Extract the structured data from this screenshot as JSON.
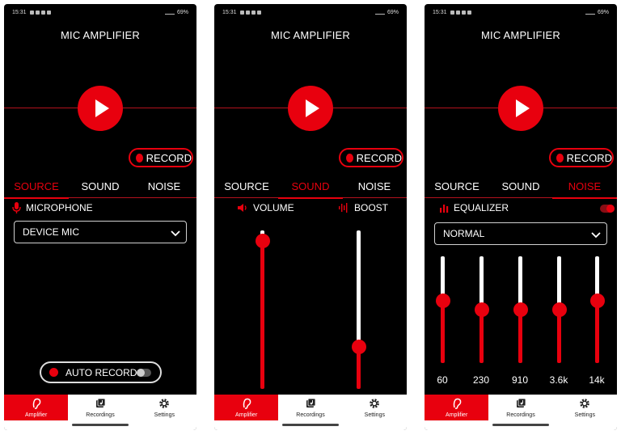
{
  "status": {
    "time": "15:31",
    "battery": "69%"
  },
  "app": {
    "title": "MIC AMPLIFIER",
    "record_label": "RECORD"
  },
  "tabs": [
    "SOURCE",
    "SOUND",
    "NOISE"
  ],
  "source": {
    "section": "MICROPHONE",
    "mic_value": "DEVICE MIC",
    "auto_record_label": "AUTO RECORD",
    "auto_record_on": false
  },
  "sound": {
    "volume_label": "VOLUME",
    "boost_label": "BOOST",
    "volume_level": 0.98,
    "boost_level": 0.24
  },
  "noise": {
    "section": "EQUALIZER",
    "equalizer_on": true,
    "preset_value": "NORMAL",
    "bands": [
      {
        "freq": "60",
        "level": 0.6
      },
      {
        "freq": "230",
        "level": 0.5
      },
      {
        "freq": "910",
        "level": 0.5
      },
      {
        "freq": "3.6k",
        "level": 0.5
      },
      {
        "freq": "14k",
        "level": 0.6
      }
    ]
  },
  "nav": [
    "Amplifier",
    "Recordings",
    "Settings"
  ],
  "colors": {
    "accent": "#e8000e",
    "background": "#000000",
    "nav_background": "#ffffff"
  }
}
